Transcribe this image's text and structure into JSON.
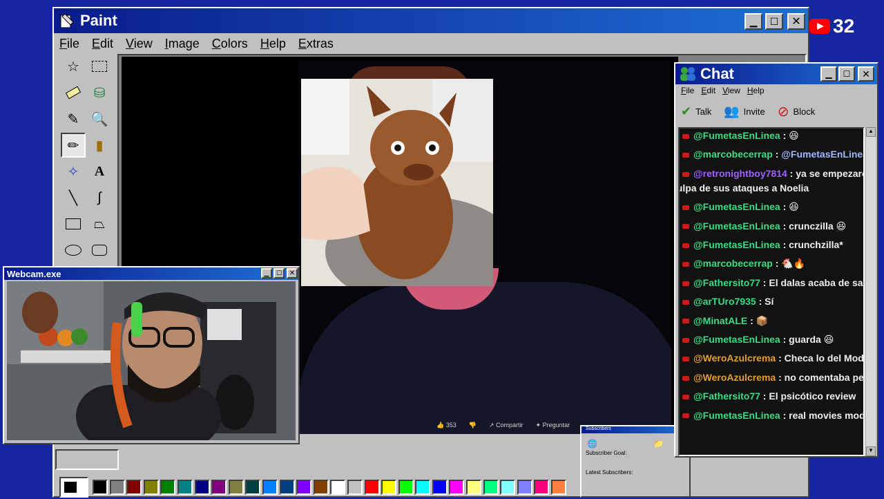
{
  "paint": {
    "title": "Paint",
    "menu": [
      "File",
      "Edit",
      "View",
      "Image",
      "Colors",
      "Help",
      "Extras"
    ],
    "palette": [
      "#000000",
      "#808080",
      "#800000",
      "#808000",
      "#008000",
      "#008080",
      "#000080",
      "#800080",
      "#808040",
      "#004040",
      "#0080ff",
      "#004080",
      "#8000ff",
      "#804000",
      "#ffffff",
      "#c0c0c0",
      "#ff0000",
      "#ffff00",
      "#00ff00",
      "#00ffff",
      "#0000ff",
      "#ff00ff",
      "#ffff80",
      "#00ff80",
      "#80ffff",
      "#8080ff",
      "#ff0080",
      "#ff8040"
    ],
    "youtube_bar": {
      "likes": "353",
      "share": "Compartir",
      "ask": "Preguntar"
    }
  },
  "webcam": {
    "title": "Webcam.exe"
  },
  "subscribers": {
    "title": "Subscribers",
    "goal_label": "Subscriber Goal:",
    "latest_label": "Latest Subscribers:"
  },
  "chat": {
    "title": "Chat",
    "menu": [
      "File",
      "Edit",
      "View",
      "Help"
    ],
    "toolbar": {
      "talk": "Talk",
      "invite": "Invite",
      "block": "Block"
    },
    "messages": [
      {
        "user": "@FumetasEnLinea",
        "user_color": "#3ddc84",
        "text": "😆"
      },
      {
        "user": "@marcobecerrap",
        "user_color": "#3ddc84",
        "text": "@FumetasEnLinea 🤣🤣",
        "text_color": "#9fb7ff"
      },
      {
        "user": "@retronightboy7814",
        "user_color": "#a060ff",
        "text": "ya se empezaron a m",
        "wrap": "culpa de sus ataques a Noelia"
      },
      {
        "user": "@FumetasEnLinea",
        "user_color": "#3ddc84",
        "text": "😆"
      },
      {
        "user": "@FumetasEnLinea",
        "user_color": "#3ddc84",
        "text": "crunczilla 😆"
      },
      {
        "user": "@FumetasEnLinea",
        "user_color": "#3ddc84",
        "text": "crunchzilla*"
      },
      {
        "user": "@marcobecerrap",
        "user_color": "#3ddc84",
        "text": "🐔🔥"
      },
      {
        "user": "@Fathersito77",
        "user_color": "#3ddc84",
        "text": "El dalas acaba de sacar otro"
      },
      {
        "user": "@arTUro7935",
        "user_color": "#3ddc84",
        "text": "Sí"
      },
      {
        "user": "@MinatALE",
        "user_color": "#3ddc84",
        "text": "📦"
      },
      {
        "user": "@FumetasEnLinea",
        "user_color": "#3ddc84",
        "text": "guarda 😆"
      },
      {
        "user": "@WeroAzulcrema",
        "user_color": "#e0a030",
        "text": "Checa lo del Mod mexi c"
      },
      {
        "user": "@WeroAzulcrema",
        "user_color": "#e0a030",
        "text": "no comentaba pero aqui"
      },
      {
        "user": "@Fathersito77",
        "user_color": "#3ddc84",
        "text": "El psicótico review"
      },
      {
        "user": "@FumetasEnLinea",
        "user_color": "#3ddc84",
        "text": "real movies mod en la p"
      }
    ]
  },
  "youtube_viewers": "32"
}
